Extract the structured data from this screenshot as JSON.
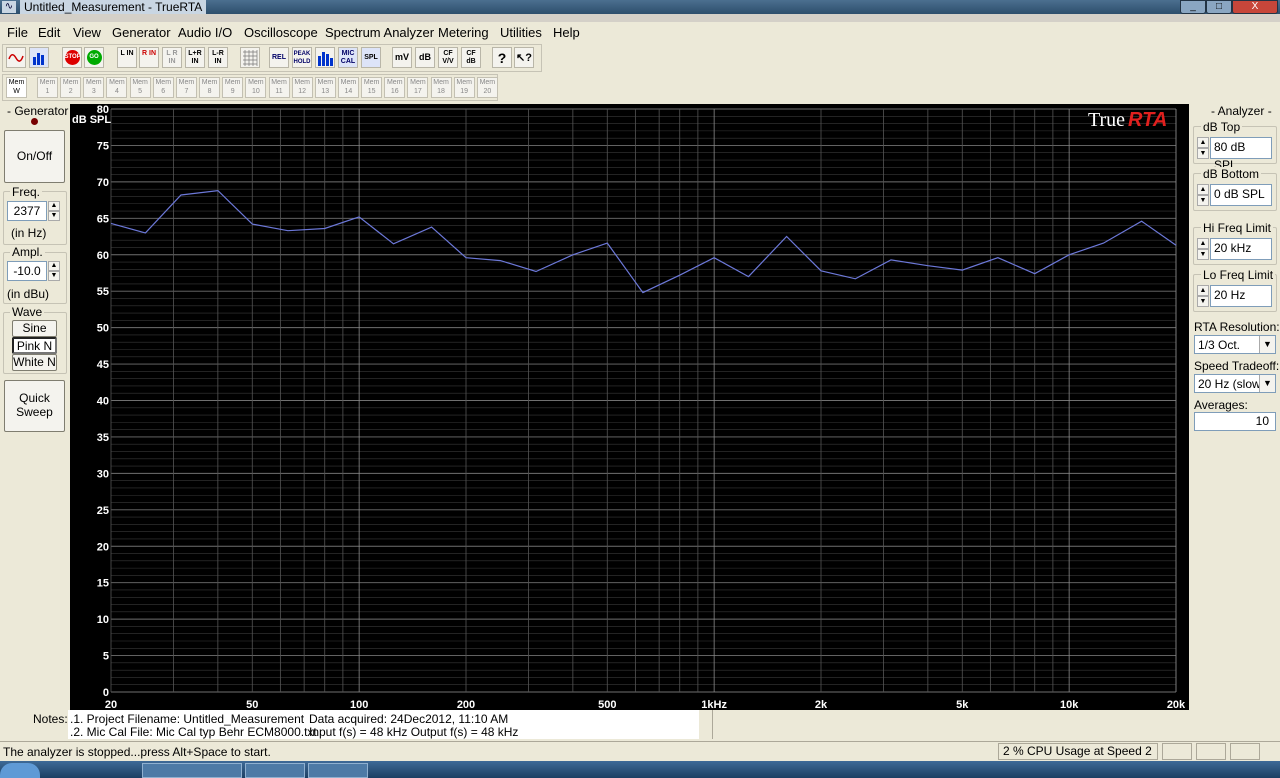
{
  "window": {
    "title": "Untitled_Measurement - TrueRTA",
    "controls": {
      "min": "_",
      "max": "□",
      "close": "X"
    }
  },
  "menu": [
    "File",
    "Edit",
    "View",
    "Generator",
    "Audio I/O",
    "Oscilloscope",
    "Spectrum Analyzer",
    "Metering",
    "Utilities",
    "Help"
  ],
  "toolbar": {
    "buttons": [
      "sine-wave",
      "spectrum",
      "STOP",
      "GO",
      "L IN",
      "R IN",
      "L R IN",
      "L+R IN",
      "L-R IN",
      "grid",
      "REL",
      "PEAK HOLD",
      "bars",
      "MIC CAL",
      "SPL",
      "mV",
      "dB",
      "CF V/V",
      "CF dB",
      "?",
      "context-help"
    ],
    "mem_active": "Mem W",
    "mem_slots": [
      "1",
      "2",
      "3",
      "4",
      "5",
      "6",
      "7",
      "8",
      "9",
      "10",
      "11",
      "12",
      "13",
      "14",
      "15",
      "16",
      "17",
      "18",
      "19",
      "20"
    ]
  },
  "generator": {
    "title": "- Generator -",
    "onoff": "On/Off",
    "freq_label": "Freq.",
    "freq_value": "2377",
    "freq_unit": "(in Hz)",
    "ampl_label": "Ampl.",
    "ampl_value": "-10.0",
    "ampl_unit": "(in dBu)",
    "wave_label": "Wave",
    "waves": [
      "Sine",
      "Pink N",
      "White N"
    ],
    "quick_sweep": "Quick Sweep"
  },
  "analyzer": {
    "title": "- Analyzer -",
    "db_top_label": "dB Top",
    "db_top_value": "80 dB SPL",
    "db_bottom_label": "dB Bottom",
    "db_bottom_value": "0 dB SPL",
    "hi_freq_label": "Hi Freq Limit",
    "hi_freq_value": "20 kHz",
    "lo_freq_label": "Lo Freq Limit",
    "lo_freq_value": "20 Hz",
    "rta_res_label": "RTA Resolution:",
    "rta_res_value": "1/3 Oct.",
    "speed_label": "Speed Tradeoff:",
    "speed_value": "20 Hz (slow)",
    "averages_label": "Averages:",
    "averages_value": "10"
  },
  "chart_data": {
    "type": "line",
    "ylabel": "dB SPL",
    "brand": {
      "a": "True",
      "b": "RTA"
    },
    "ylim": [
      0,
      80
    ],
    "xlim": [
      20,
      20000
    ],
    "xscale": "log",
    "y_ticks": [
      "80",
      "75",
      "70",
      "65",
      "60",
      "55",
      "50",
      "45",
      "40",
      "35",
      "30",
      "25",
      "20",
      "15",
      "10",
      "5",
      "0"
    ],
    "x_ticks": [
      {
        "v": 20,
        "label": "20"
      },
      {
        "v": 50,
        "label": "50"
      },
      {
        "v": 100,
        "label": "100"
      },
      {
        "v": 200,
        "label": "200"
      },
      {
        "v": 500,
        "label": "500"
      },
      {
        "v": 1000,
        "label": "1kHz"
      },
      {
        "v": 2000,
        "label": "2k"
      },
      {
        "v": 5000,
        "label": "5k"
      },
      {
        "v": 10000,
        "label": "10k"
      },
      {
        "v": 20000,
        "label": "20k"
      }
    ],
    "grid": true,
    "line_color": "#6c78d8",
    "series": [
      {
        "x": [
          20,
          25,
          31.5,
          40,
          50,
          63,
          80,
          100,
          125,
          160,
          200,
          250,
          315,
          400,
          500,
          630,
          800,
          1000,
          1250,
          1600,
          2000,
          2500,
          3150,
          4000,
          5000,
          6300,
          8000,
          10000,
          12500,
          16000,
          20000
        ],
        "values": [
          64.3,
          63.0,
          68.2,
          68.8,
          64.2,
          63.3,
          63.6,
          65.2,
          61.5,
          63.8,
          59.6,
          59.2,
          57.7,
          60.0,
          61.6,
          54.8,
          57.2,
          59.6,
          57.0,
          62.5,
          57.8,
          56.7,
          59.3,
          58.5,
          57.9,
          59.6,
          57.4,
          60.0,
          61.6,
          64.6,
          61.3
        ]
      }
    ]
  },
  "notes": {
    "label": "Notes:",
    "line1_a": ".1. Project Filename: Untitled_Measurement",
    "line1_b": "Data acquired: 24Dec2012, 11:10 AM",
    "line2_a": ".2. Mic Cal File: Mic Cal typ Behr ECM8000.txt",
    "line2_b": "Input f(s) = 48 kHz   Output f(s) = 48 kHz"
  },
  "status": {
    "message": "The analyzer is stopped...press Alt+Space to start.",
    "cpu": "2 % CPU Usage at Speed 2"
  }
}
